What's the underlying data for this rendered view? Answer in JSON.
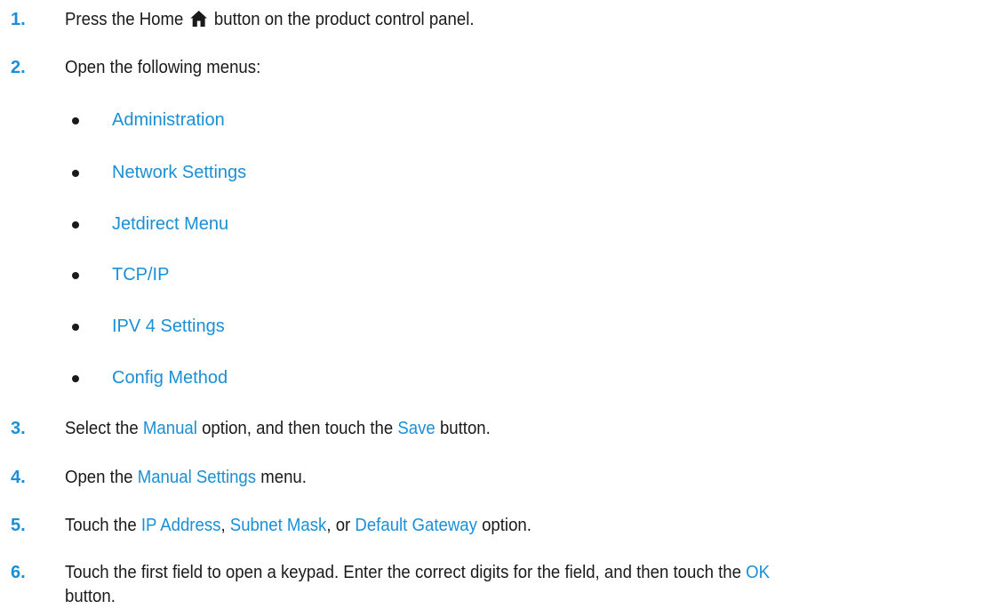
{
  "steps": [
    {
      "num": "1.",
      "pre": "Press the Home ",
      "post": " button on the product control panel.",
      "icon": "home-icon"
    },
    {
      "num": "2.",
      "text": "Open the following menus:"
    },
    {
      "num": "3.",
      "pre": "Select the ",
      "kw1": "Manual",
      "mid": " option, and then touch the ",
      "kw2": "Save",
      "post": " button."
    },
    {
      "num": "4.",
      "pre": "Open the ",
      "kw1": "Manual Settings",
      "post": " menu."
    },
    {
      "num": "5.",
      "pre": "Touch the ",
      "kw1": "IP Address",
      "sep1": ", ",
      "kw2": "Subnet Mask",
      "sep2": ", or ",
      "kw3": "Default Gateway",
      "post": " option."
    },
    {
      "num": "6.",
      "pre": "Touch the first field to open a keypad. Enter the correct digits for the field, and then touch the ",
      "kw1": "OK",
      "line2": "button."
    }
  ],
  "menus": [
    "Administration",
    "Network Settings",
    "Jetdirect Menu",
    "TCP/IP",
    "IPV 4 Settings",
    "Config Method"
  ],
  "colors": {
    "accent": "#1a8fd6",
    "text": "#1a1a1a"
  }
}
